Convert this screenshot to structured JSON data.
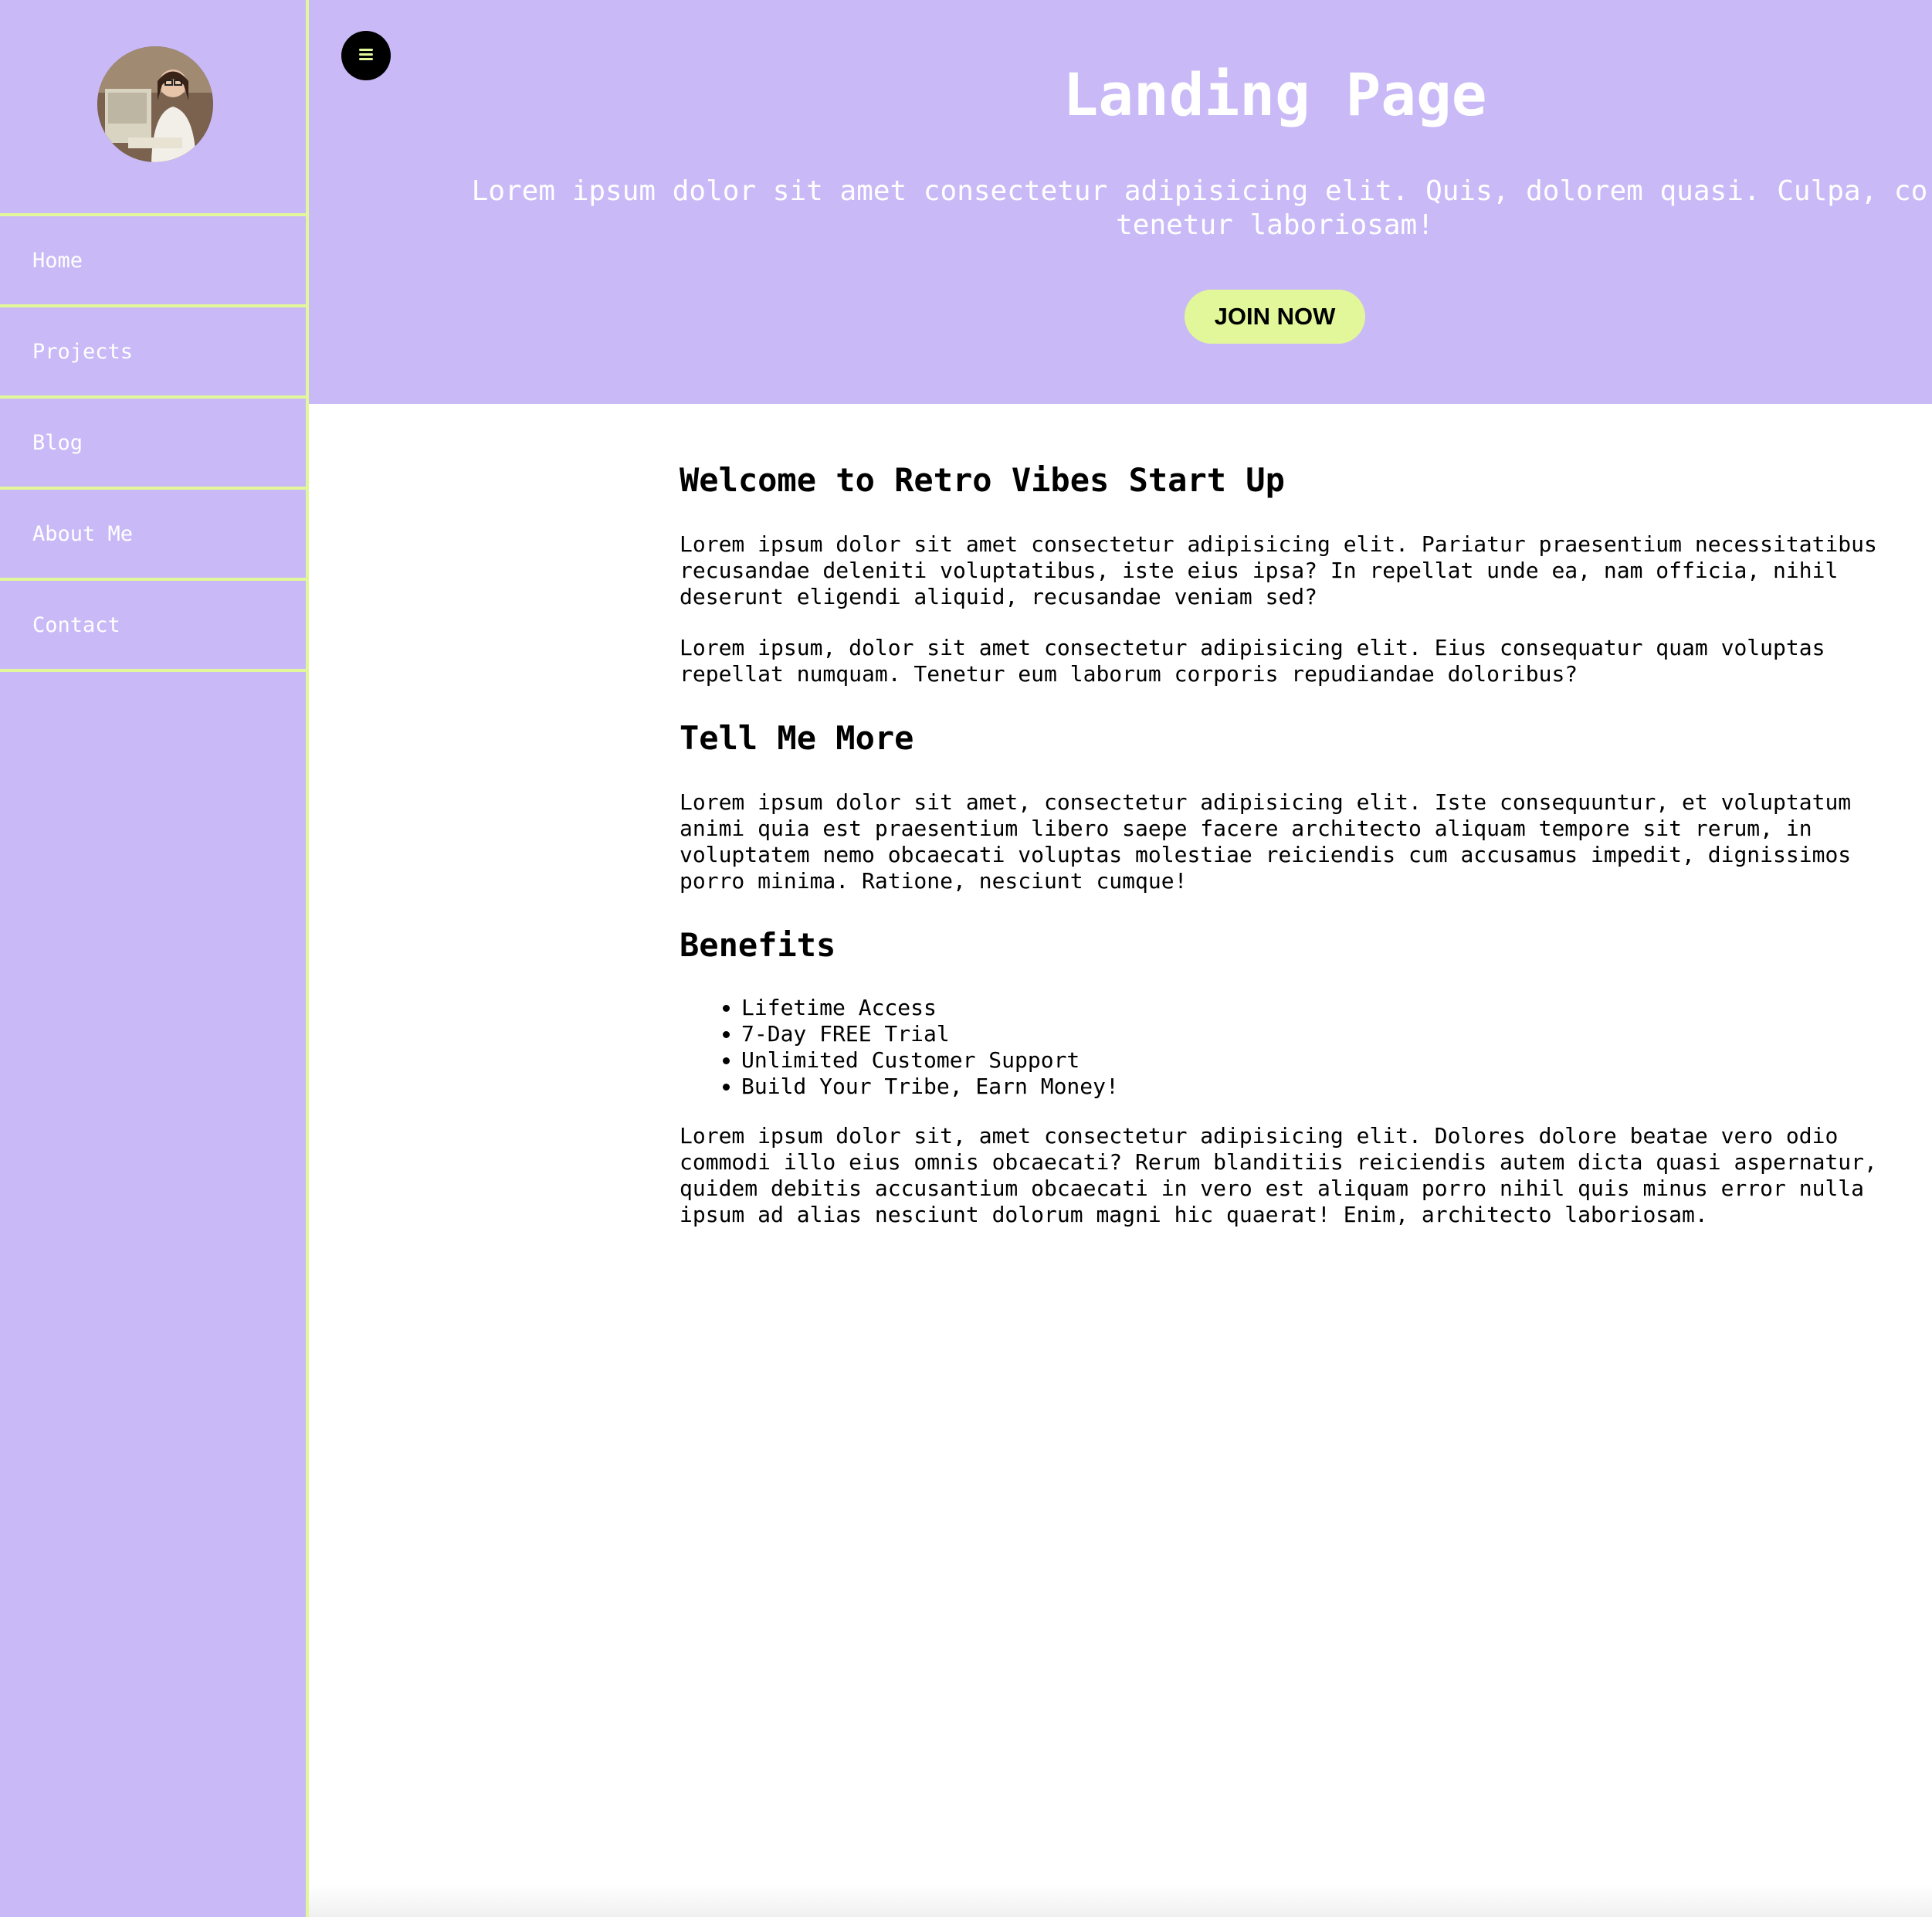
{
  "sidebar": {
    "avatar_alt": "profile photo",
    "items": [
      {
        "label": "Home"
      },
      {
        "label": "Projects"
      },
      {
        "label": "Blog"
      },
      {
        "label": "About Me"
      },
      {
        "label": "Contact"
      }
    ]
  },
  "hero": {
    "menu_icon": "hamburger-icon",
    "title": "Landing Page",
    "subtitle_line1": "Lorem ipsum dolor sit amet consectetur adipisicing elit. Quis, dolorem quasi. Culpa, corporis an",
    "subtitle_line2": "tenetur laboriosam!",
    "cta_label": "JOIN NOW"
  },
  "content": {
    "welcome_heading": "Welcome to Retro Vibes Start Up",
    "para1": "Lorem ipsum dolor sit amet consectetur adipisicing elit. Pariatur praesentium necessitatibus recusandae deleniti voluptatibus, iste eius ipsa? In repellat unde ea, nam officia, nihil deserunt eligendi aliquid, recusandae veniam sed?",
    "para2": "Lorem ipsum, dolor sit amet consectetur adipisicing elit. Eius consequatur quam voluptas repellat numquam. Tenetur eum laborum corporis repudiandae doloribus?",
    "more_heading": "Tell Me More",
    "para3": "Lorem ipsum dolor sit amet, consectetur adipisicing elit. Iste consequuntur, et voluptatum animi quia est praesentium libero saepe facere architecto aliquam tempore sit rerum, in voluptatem nemo obcaecati voluptas molestiae reiciendis cum accusamus impedit, dignissimos porro minima. Ratione, nesciunt cumque!",
    "benefits_heading": "Benefits",
    "benefits": [
      "Lifetime Access",
      "7-Day FREE Trial",
      "Unlimited Customer Support",
      "Build Your Tribe, Earn Money!"
    ],
    "para4": "Lorem ipsum dolor sit, amet consectetur adipisicing elit. Dolores dolore beatae vero odio commodi illo eius omnis obcaecati? Rerum blanditiis reiciendis autem dicta quasi aspernatur, quidem debitis accusantium obcaecati in vero est aliquam porro nihil quis minus error nulla ipsum ad alias nesciunt dolorum magni hic quaerat! Enim, architecto laboriosam."
  },
  "colors": {
    "lavender": "#c9baf7",
    "lime": "#e2f799",
    "text": "#000000"
  }
}
